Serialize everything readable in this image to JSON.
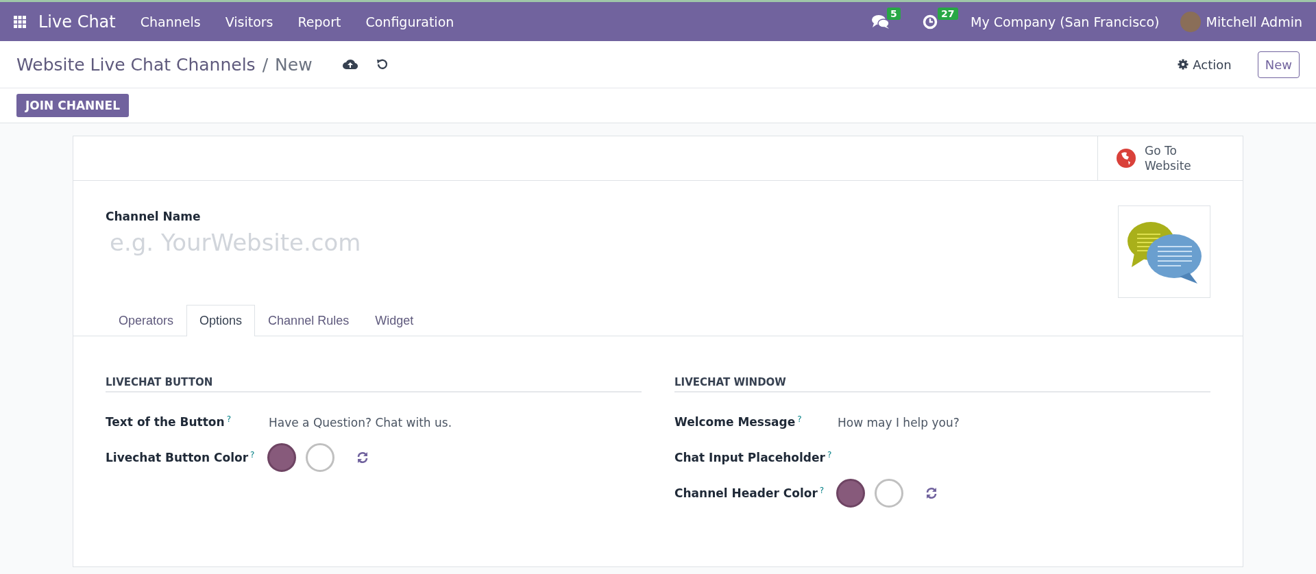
{
  "navbar": {
    "app_name": "Live Chat",
    "menu": [
      "Channels",
      "Visitors",
      "Report",
      "Configuration"
    ],
    "messages_count": "5",
    "activities_count": "27",
    "company": "My Company (San Francisco)",
    "user": "Mitchell Admin"
  },
  "control_panel": {
    "breadcrumb": "Website Live Chat Channels",
    "separator": "/",
    "current": "New",
    "action_label": "Action",
    "new_label": "New"
  },
  "status_buttons": [
    "JOIN CHANNEL"
  ],
  "smart_button": {
    "label": "Go To Website"
  },
  "form": {
    "name_label": "Channel Name",
    "name_placeholder": "e.g. YourWebsite.com",
    "tabs": [
      {
        "label": "Operators",
        "selected": false
      },
      {
        "label": "Options",
        "selected": true
      },
      {
        "label": "Channel Rules",
        "selected": false
      },
      {
        "label": "Widget",
        "selected": false
      }
    ],
    "groups": [
      {
        "title": "LIVECHAT BUTTON",
        "fields": [
          {
            "kind": "text",
            "label": "Text of the Button",
            "help": "?",
            "value": "Have a Question? Chat with us."
          },
          {
            "kind": "color",
            "label": "Livechat Button Color",
            "help": "?",
            "colors": [
              {
                "color": "#875a7b"
              },
              {
                "color": "#ffffff"
              }
            ]
          }
        ]
      },
      {
        "title": "LIVECHAT WINDOW",
        "fields": [
          {
            "kind": "text",
            "label": "Welcome Message",
            "help": "?",
            "value": "How may I help you?"
          },
          {
            "kind": "text",
            "label": "Chat Input Placeholder",
            "help": "?"
          },
          {
            "kind": "color",
            "label": "Channel Header Color",
            "help": "?",
            "colors": [
              {
                "color": "#875a7b"
              },
              {
                "color": "#ffffff"
              }
            ]
          }
        ]
      }
    ]
  }
}
